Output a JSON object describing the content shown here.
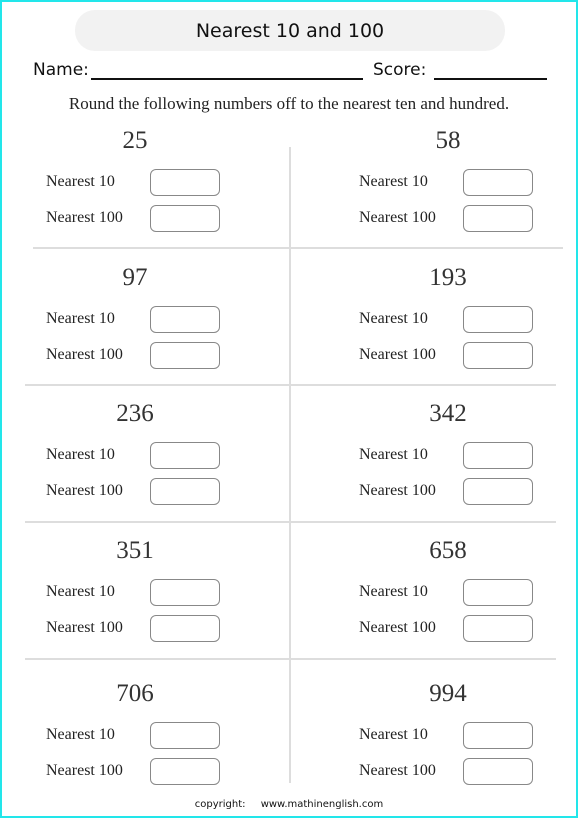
{
  "title": "Nearest 10 and 100",
  "name_label": "Name:",
  "score_label": "Score:",
  "instructions": "Round the following numbers off to the nearest ten and hundred.",
  "row_labels": {
    "nearest_10": "Nearest 10",
    "nearest_100": "Nearest 100"
  },
  "problems": [
    {
      "number": "25"
    },
    {
      "number": "58"
    },
    {
      "number": "97"
    },
    {
      "number": "193"
    },
    {
      "number": "236"
    },
    {
      "number": "342"
    },
    {
      "number": "351"
    },
    {
      "number": "658"
    },
    {
      "number": "706"
    },
    {
      "number": "994"
    }
  ],
  "footer": {
    "copyright_label": "copyright:",
    "website": "www.mathinenglish.com"
  },
  "colors": {
    "frame": "#22e6ea",
    "title_bg": "#f2f2f2",
    "divider": "#dddddd"
  }
}
